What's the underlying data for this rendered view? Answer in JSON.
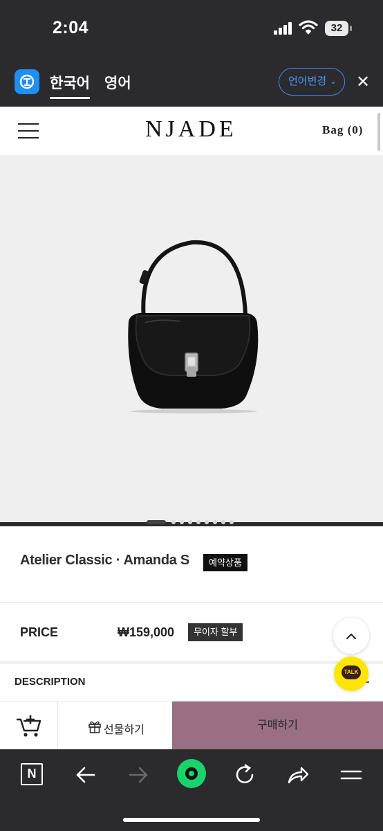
{
  "status_bar": {
    "time": "2:04",
    "battery": "32"
  },
  "translate_bar": {
    "tab_korean": "한국어",
    "tab_english": "영어",
    "change_language": "언어변경",
    "chevron": "⌄",
    "close": "✕"
  },
  "header": {
    "logo": "NJADE",
    "bag": "Bag (0)"
  },
  "product": {
    "title": "Atelier Classic · Amanda S",
    "badge": "예약상품",
    "price_label": "PRICE",
    "price": "₩159,000",
    "installment": "무이자 할부",
    "description_label": "DESCRIPTION",
    "carousel_count": 10,
    "carousel_active_index": 0
  },
  "floating": {
    "scroll_top": "⌃",
    "kakao": "TALK"
  },
  "action_bar": {
    "gift": "선물하기",
    "buy": "구매하기"
  },
  "toolbar": {
    "n_label": "N"
  },
  "icons": [
    "signal-icon",
    "wifi-icon",
    "battery-icon",
    "translate-logo-icon",
    "close-icon",
    "menu-icon",
    "scroll-top-icon",
    "kakao-talk-icon",
    "cart-add-icon",
    "gift-icon",
    "n-icon",
    "back-arrow-icon",
    "forward-arrow-icon",
    "green-circle-icon",
    "reload-icon",
    "share-icon",
    "menu-lines-icon"
  ],
  "colors": {
    "accent_blue": "#3d8af7",
    "buy_button": "#9a6f84",
    "kakao_yellow": "#ffe600",
    "green": "#19d36b"
  }
}
